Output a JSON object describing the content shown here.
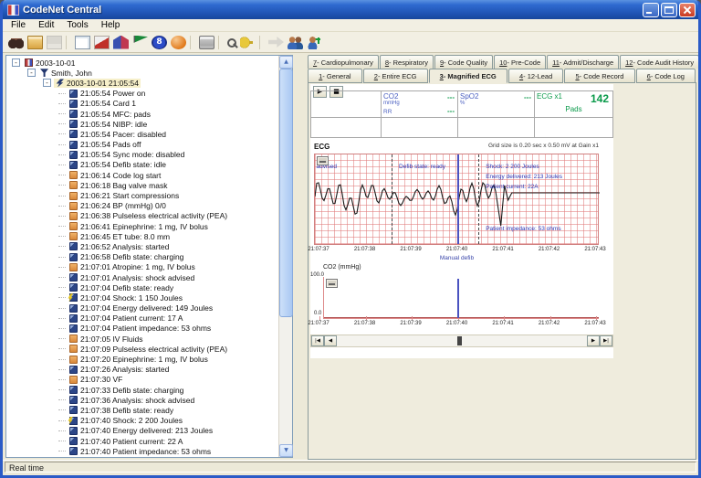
{
  "window": {
    "title": "CodeNet Central"
  },
  "menu": {
    "items": [
      "File",
      "Edit",
      "Tools",
      "Help"
    ]
  },
  "toolbar": {
    "icons": [
      {
        "name": "binoculars-icon"
      },
      {
        "name": "open-folder-icon"
      },
      {
        "name": "save-icon",
        "disabled": true
      },
      {
        "name": "new-report-icon"
      },
      {
        "name": "marker-icon"
      },
      {
        "name": "chart-icon"
      },
      {
        "name": "flag-icon"
      },
      {
        "name": "bluetooth-icon",
        "glyph": "8"
      },
      {
        "name": "ball-icon"
      },
      {
        "name": "print-icon"
      },
      {
        "name": "search-icon"
      },
      {
        "name": "key-icon"
      },
      {
        "name": "export-icon",
        "disabled": true
      },
      {
        "name": "users-icon"
      },
      {
        "name": "add-user-icon"
      }
    ],
    "separators_after": [
      2,
      8,
      9,
      11
    ]
  },
  "tree": {
    "expander_glyph": "-",
    "items": [
      {
        "lvl": 0,
        "icon": "calendar",
        "exp": "-",
        "text": "2003-10-01"
      },
      {
        "lvl": 1,
        "icon": "patient",
        "exp": "-",
        "text": "Smith, John"
      },
      {
        "lvl": 2,
        "icon": "event",
        "exp": "-",
        "text": "2003-10-01 21:05:54",
        "sel": true
      },
      {
        "lvl": 3,
        "icon": "device",
        "text": "21:05:54 Power on"
      },
      {
        "lvl": 3,
        "icon": "device",
        "text": "21:05:54 Card 1"
      },
      {
        "lvl": 3,
        "icon": "device",
        "text": "21:05:54 MFC: pads"
      },
      {
        "lvl": 3,
        "icon": "device",
        "text": "21:05:54 NIBP: idle"
      },
      {
        "lvl": 3,
        "icon": "device",
        "text": "21:05:54 Pacer: disabled"
      },
      {
        "lvl": 3,
        "icon": "device",
        "text": "21:05:54 Pads off"
      },
      {
        "lvl": 3,
        "icon": "device",
        "text": "21:05:54 Sync mode: disabled"
      },
      {
        "lvl": 3,
        "icon": "device",
        "text": "21:05:54 Defib state: idle"
      },
      {
        "lvl": 3,
        "icon": "therapy",
        "text": "21:06:14 Code log start"
      },
      {
        "lvl": 3,
        "icon": "therapy",
        "text": "21:06:18 Bag valve mask"
      },
      {
        "lvl": 3,
        "icon": "therapy",
        "text": "21:06:21 Start compressions"
      },
      {
        "lvl": 3,
        "icon": "therapy",
        "text": "21:06:24 BP (mmHg) 0/0"
      },
      {
        "lvl": 3,
        "icon": "therapy",
        "text": "21:06:38 Pulseless electrical activity (PEA)"
      },
      {
        "lvl": 3,
        "icon": "therapy",
        "text": "21:06:41 Epinephrine: 1 mg, IV bolus"
      },
      {
        "lvl": 3,
        "icon": "therapy",
        "text": "21:06:45 ET tube: 8.0 mm"
      },
      {
        "lvl": 3,
        "icon": "device",
        "text": "21:06:52 Analysis: started"
      },
      {
        "lvl": 3,
        "icon": "device",
        "text": "21:06:58 Defib state: charging"
      },
      {
        "lvl": 3,
        "icon": "therapy",
        "text": "21:07:01 Atropine: 1 mg, IV bolus"
      },
      {
        "lvl": 3,
        "icon": "device",
        "text": "21:07:01 Analysis: shock advised"
      },
      {
        "lvl": 3,
        "icon": "device",
        "text": "21:07:04 Defib state: ready"
      },
      {
        "lvl": 3,
        "icon": "shock",
        "text": "21:07:04 Shock: 1 150 Joules"
      },
      {
        "lvl": 3,
        "icon": "device",
        "text": "21:07:04 Energy delivered: 149 Joules"
      },
      {
        "lvl": 3,
        "icon": "device",
        "text": "21:07:04 Patient current: 17 A"
      },
      {
        "lvl": 3,
        "icon": "device",
        "text": "21:07:04 Patient impedance: 53 ohms"
      },
      {
        "lvl": 3,
        "icon": "therapy",
        "text": "21:07:05 IV Fluids"
      },
      {
        "lvl": 3,
        "icon": "therapy",
        "text": "21:07:09 Pulseless electrical activity (PEA)"
      },
      {
        "lvl": 3,
        "icon": "therapy",
        "text": "21:07:20 Epinephrine: 1 mg, IV bolus"
      },
      {
        "lvl": 3,
        "icon": "device",
        "text": "21:07:26 Analysis: started"
      },
      {
        "lvl": 3,
        "icon": "therapy",
        "text": "21:07:30 VF"
      },
      {
        "lvl": 3,
        "icon": "device",
        "text": "21:07:33 Defib state: charging"
      },
      {
        "lvl": 3,
        "icon": "device",
        "text": "21:07:36 Analysis: shock advised"
      },
      {
        "lvl": 3,
        "icon": "device",
        "text": "21:07:38 Defib state: ready"
      },
      {
        "lvl": 3,
        "icon": "shock",
        "text": "21:07:40 Shock: 2 200 Joules"
      },
      {
        "lvl": 3,
        "icon": "device",
        "text": "21:07:40 Energy delivered: 213 Joules"
      },
      {
        "lvl": 3,
        "icon": "device",
        "text": "21:07:40 Patient current: 22 A"
      },
      {
        "lvl": 3,
        "icon": "device",
        "text": "21:07:40 Patient impedance: 53 ohms"
      }
    ]
  },
  "tabs": {
    "upper": [
      {
        "num": "7",
        "rest": " - Cardiopulmonary"
      },
      {
        "num": "8",
        "rest": " - Respiratory"
      },
      {
        "num": "9",
        "rest": " - Code Quality"
      },
      {
        "num": "10",
        "rest": " - Pre-Code"
      },
      {
        "num": "11",
        "rest": " - Admit/Discharge"
      },
      {
        "num": "12",
        "rest": " - Code Audit History"
      }
    ],
    "lower": [
      {
        "num": "1",
        "rest": " - General"
      },
      {
        "num": "2",
        "rest": " - Entire ECG"
      },
      {
        "num": "3",
        "rest": " - Magnified ECG",
        "active": true
      },
      {
        "num": "4",
        "rest": " - 12-Lead"
      },
      {
        "num": "5",
        "rest": " - Code Record"
      },
      {
        "num": "6",
        "rest": " - Code Log"
      }
    ]
  },
  "transport": {
    "play_glyph": "▶",
    "stop_glyph": "■"
  },
  "vitals": {
    "co2": {
      "label": "CO2",
      "unit": "mmHg",
      "sub_label": "RR",
      "value": "---",
      "sub_value": "---"
    },
    "spo2": {
      "label": "SpO2",
      "unit": "%",
      "value": "---"
    },
    "ecg": {
      "label": "ECG x1",
      "hr": "142",
      "mode": "Pads"
    }
  },
  "statusbar": {
    "text": "Real time"
  },
  "scroll_glyphs": {
    "up": "▲",
    "down": "▼",
    "left": "◀",
    "right": "▶",
    "home": "|◀",
    "end": "▶|"
  },
  "chart_data": [
    {
      "type": "line",
      "title": "ECG",
      "note": "Grid size is 0.20 sec x 0.50 mV at Gain x1",
      "x_ticks": [
        "21:07:37",
        "21:07:38",
        "21:07:39",
        "21:07:40",
        "21:07:41",
        "21:07:42",
        "21:07:43"
      ],
      "cursor_tick": "21:07:40",
      "cursor_label": "Manual defib",
      "annotations": [
        {
          "text": "advised",
          "fx": 0.005,
          "fy": 0.1
        },
        {
          "text": "Defib state: ready",
          "fx": 0.295,
          "fy": 0.1
        },
        {
          "text": "Shock: 2 200 Joules",
          "fx": 0.6,
          "fy": 0.1
        },
        {
          "text": "Energy delivered: 213 Joules",
          "fx": 0.6,
          "fy": 0.21
        },
        {
          "text": "Patient current: 22A",
          "fx": 0.6,
          "fy": 0.32
        },
        {
          "text": "Patient impedance: 53 ohms",
          "fx": 0.6,
          "fy": 0.78
        }
      ],
      "dashed_marker_fx": [
        0.27,
        0.575
      ],
      "waveform": {
        "pattern": "coarse ventricular fibrillation until defib shock at 21:07:40, then near-flat baseline",
        "vf_end_fx": 0.64,
        "baseline_fy": 0.46,
        "flat_fy": 0.42,
        "amp_mV": 1.0
      },
      "grid": "red 0.20 sec x 0.50 mV squares"
    },
    {
      "type": "line",
      "title": "CO2 (mmHg)",
      "ylim": [
        0,
        100
      ],
      "y_ticks": [
        "100.0",
        "0.0"
      ],
      "x_ticks": [
        "21:07:37",
        "21:07:38",
        "21:07:39",
        "21:07:40",
        "21:07:41",
        "21:07:42",
        "21:07:43"
      ],
      "cursor_tick": "21:07:40",
      "values_constant": 0
    }
  ]
}
